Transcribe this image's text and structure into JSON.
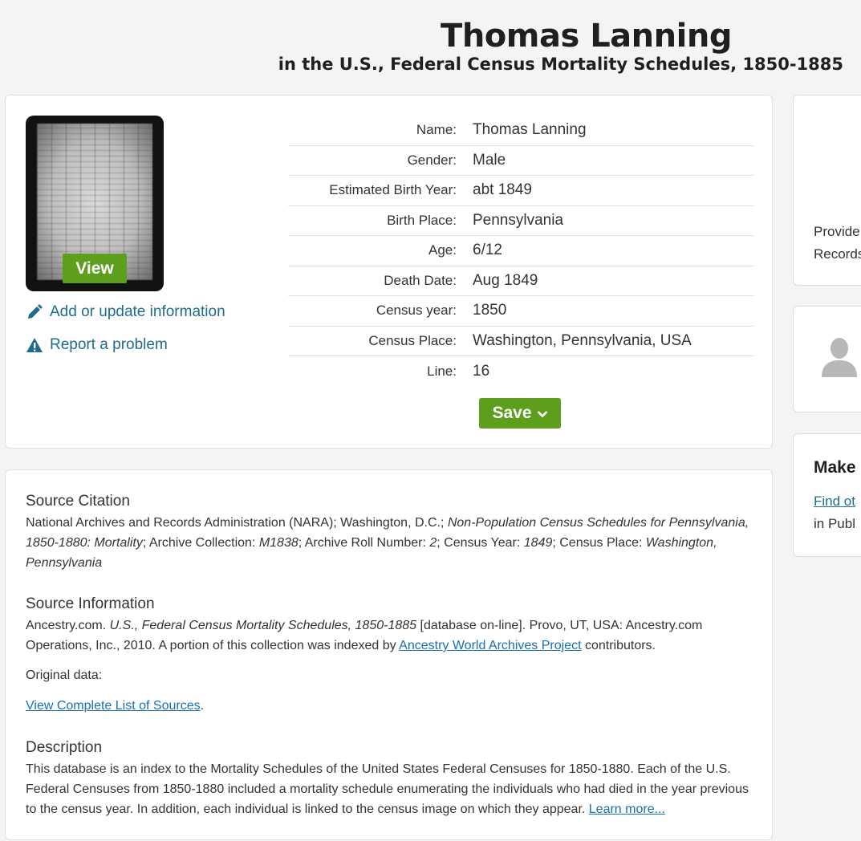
{
  "header": {
    "title": "Thomas Lanning",
    "subtitle": "in the U.S., Federal Census Mortality Schedules, 1850-1885"
  },
  "record": {
    "view_label": "View",
    "add_update_label": "Add or update information",
    "report_label": "Report a problem",
    "save_label": "Save",
    "fields": [
      {
        "label": "Name:",
        "value": "Thomas Lanning"
      },
      {
        "label": "Gender:",
        "value": "Male"
      },
      {
        "label": "Estimated Birth Year:",
        "value": "abt 1849"
      },
      {
        "label": "Birth Place:",
        "value": "Pennsylvania"
      },
      {
        "label": "Age:",
        "value": "6/12"
      },
      {
        "label": "Death Date:",
        "value": "Aug 1849"
      },
      {
        "label": "Census year:",
        "value": "1850"
      },
      {
        "label": "Census Place:",
        "value": "Washington, Pennsylvania, USA"
      },
      {
        "label": "Line:",
        "value": "16"
      }
    ]
  },
  "source": {
    "citation_heading": "Source Citation",
    "citation_parts": {
      "p1": "National Archives and Records Administration (NARA); Washington, D.C.; ",
      "p2": "Non-Population Census Schedules for Pennsylvania, 1850-1880: Mortality",
      "p3": "; Archive Collection: ",
      "p4": "M1838",
      "p5": "; Archive Roll Number: ",
      "p6": "2",
      "p7": "; Census Year: ",
      "p8": "1849",
      "p9": "; Census Place: ",
      "p10": "Washington, Pennsylvania"
    },
    "info_heading": "Source Information",
    "info_parts": {
      "p1": "Ancestry.com. ",
      "p2": "U.S., Federal Census Mortality Schedules, 1850-1885",
      "p3": " [database on-line]. Provo, UT, USA: Ancestry.com Operations, Inc., 2010. A portion of this collection was indexed by ",
      "link": "Ancestry World Archives Project",
      "p4": " contributors."
    },
    "original_data_label": "Original data:",
    "view_sources_link": "View Complete List of Sources",
    "view_sources_period": ".",
    "description_heading": "Description",
    "description_text": "This database is an index to the Mortality Schedules of the United States Federal Censuses for 1850-1880. Each of the U.S. Federal Censuses from 1850-1880 included a mortality schedule enumerating the individuals who had died in the year previous to the census year. In addition, each individual is linked to the census image on which they appear. ",
    "learn_more_link": "Learn more..."
  },
  "sidebar": {
    "card1_line1": "Provide",
    "card1_line2": "Records",
    "card3_heading": "Make",
    "card3_link": "Find ot",
    "card3_sub": "in Publ"
  },
  "colors": {
    "accent_green": "#5e9e1d",
    "link_blue": "#1f6b8e",
    "background": "#f4f4f4"
  }
}
